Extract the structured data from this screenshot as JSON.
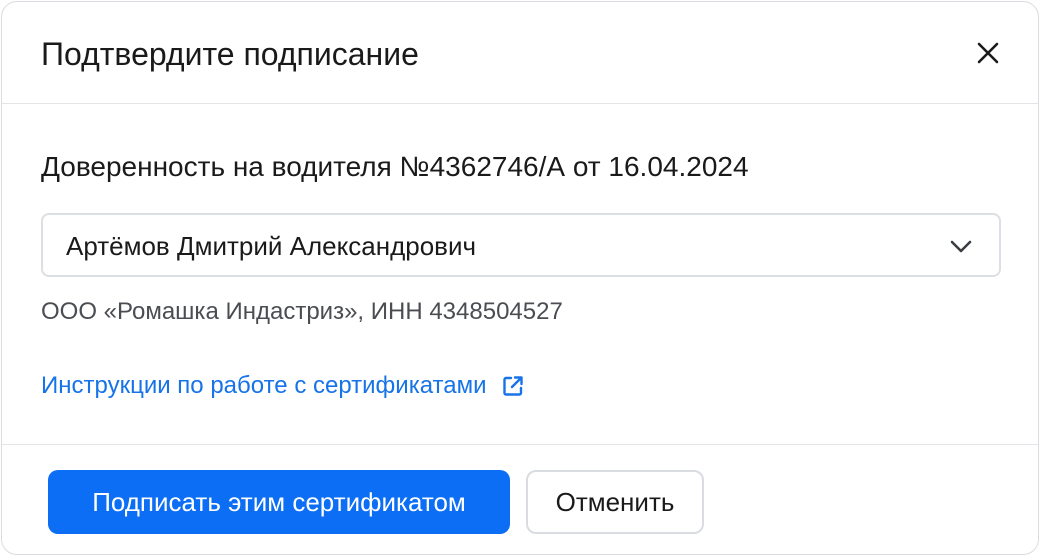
{
  "dialog": {
    "title": "Подтвердите подписание",
    "close_icon": "close-icon"
  },
  "document": {
    "title": "Доверенность на водителя №4362746/А от 16.04.2024"
  },
  "certificate_select": {
    "selected": "Артёмов Дмитрий Александрович",
    "icon": "chevron-down-icon"
  },
  "organization": {
    "text": "ООО «Ромашка Индастриз», ИНН 4348504527"
  },
  "help_link": {
    "label": "Инструкции по работе с сертификатами",
    "icon": "external-link-icon"
  },
  "footer": {
    "sign_label": "Подписать этим сертификатом",
    "cancel_label": "Отменить"
  },
  "colors": {
    "primary": "#0b6ef5",
    "link": "#1673e8",
    "text": "#1a1a1a",
    "muted": "#4a4d52"
  }
}
